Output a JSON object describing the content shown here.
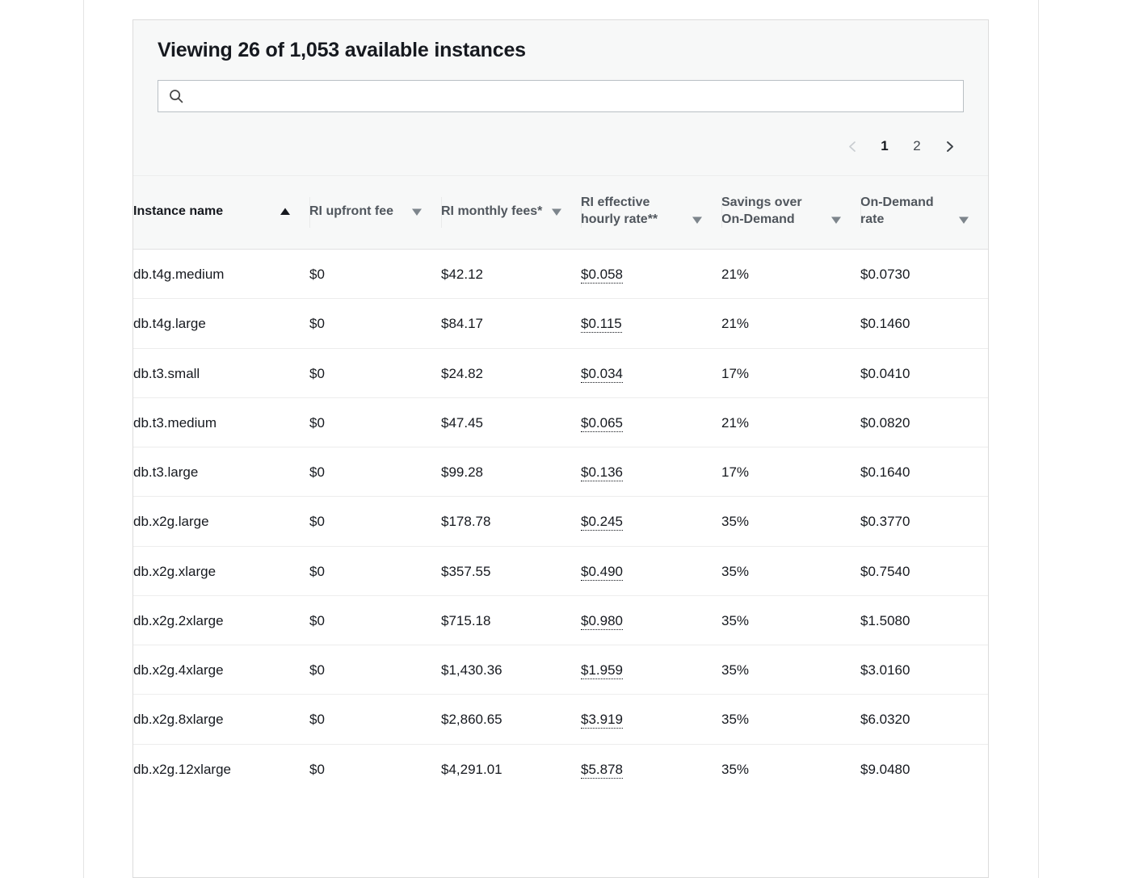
{
  "panel": {
    "title": "Viewing 26 of 1,053 available instances"
  },
  "search": {
    "value": "",
    "placeholder": "",
    "icon": "search-icon"
  },
  "pagination": {
    "prev_icon": "chevron-left-icon",
    "next_icon": "chevron-right-icon",
    "pages": [
      "1",
      "2"
    ],
    "current_page": "1"
  },
  "table": {
    "columns": [
      {
        "label": "Instance name",
        "sort": "asc",
        "sort_icon": "triangle-up-icon"
      },
      {
        "label": "RI upfront fee",
        "sort": "none",
        "sort_icon": "triangle-down-icon"
      },
      {
        "label": "RI monthly fees*",
        "sort": "none",
        "sort_icon": "triangle-down-icon"
      },
      {
        "label": "RI effective hourly rate**",
        "sort": "none",
        "sort_icon": "triangle-down-icon"
      },
      {
        "label": "Savings over On-Demand",
        "sort": "none",
        "sort_icon": "triangle-down-icon"
      },
      {
        "label": "On-Demand rate",
        "sort": "none",
        "sort_icon": "triangle-down-icon"
      }
    ],
    "rows": [
      {
        "instance": "db.t4g.medium",
        "upfront": "$0",
        "monthly": "$42.12",
        "hourly": "$0.058",
        "savings": "21%",
        "ondemand": "$0.0730"
      },
      {
        "instance": "db.t4g.large",
        "upfront": "$0",
        "monthly": "$84.17",
        "hourly": "$0.115",
        "savings": "21%",
        "ondemand": "$0.1460"
      },
      {
        "instance": "db.t3.small",
        "upfront": "$0",
        "monthly": "$24.82",
        "hourly": "$0.034",
        "savings": "17%",
        "ondemand": "$0.0410"
      },
      {
        "instance": "db.t3.medium",
        "upfront": "$0",
        "monthly": "$47.45",
        "hourly": "$0.065",
        "savings": "21%",
        "ondemand": "$0.0820"
      },
      {
        "instance": "db.t3.large",
        "upfront": "$0",
        "monthly": "$99.28",
        "hourly": "$0.136",
        "savings": "17%",
        "ondemand": "$0.1640"
      },
      {
        "instance": "db.x2g.large",
        "upfront": "$0",
        "monthly": "$178.78",
        "hourly": "$0.245",
        "savings": "35%",
        "ondemand": "$0.3770"
      },
      {
        "instance": "db.x2g.xlarge",
        "upfront": "$0",
        "monthly": "$357.55",
        "hourly": "$0.490",
        "savings": "35%",
        "ondemand": "$0.7540"
      },
      {
        "instance": "db.x2g.2xlarge",
        "upfront": "$0",
        "monthly": "$715.18",
        "hourly": "$0.980",
        "savings": "35%",
        "ondemand": "$1.5080"
      },
      {
        "instance": "db.x2g.4xlarge",
        "upfront": "$0",
        "monthly": "$1,430.36",
        "hourly": "$1.959",
        "savings": "35%",
        "ondemand": "$3.0160"
      },
      {
        "instance": "db.x2g.8xlarge",
        "upfront": "$0",
        "monthly": "$2,860.65",
        "hourly": "$3.919",
        "savings": "35%",
        "ondemand": "$6.0320"
      },
      {
        "instance": "db.x2g.12xlarge",
        "upfront": "$0",
        "monthly": "$4,291.01",
        "hourly": "$5.878",
        "savings": "35%",
        "ondemand": "$9.0480"
      }
    ]
  },
  "colors": {
    "page_background": "#ffffff",
    "card_background": "#ffffff",
    "header_background": "#f7f8f8",
    "border": "#dcdcdc",
    "row_divider": "#ededed",
    "text_primary": "#16191f",
    "text_header": "#50565d"
  }
}
